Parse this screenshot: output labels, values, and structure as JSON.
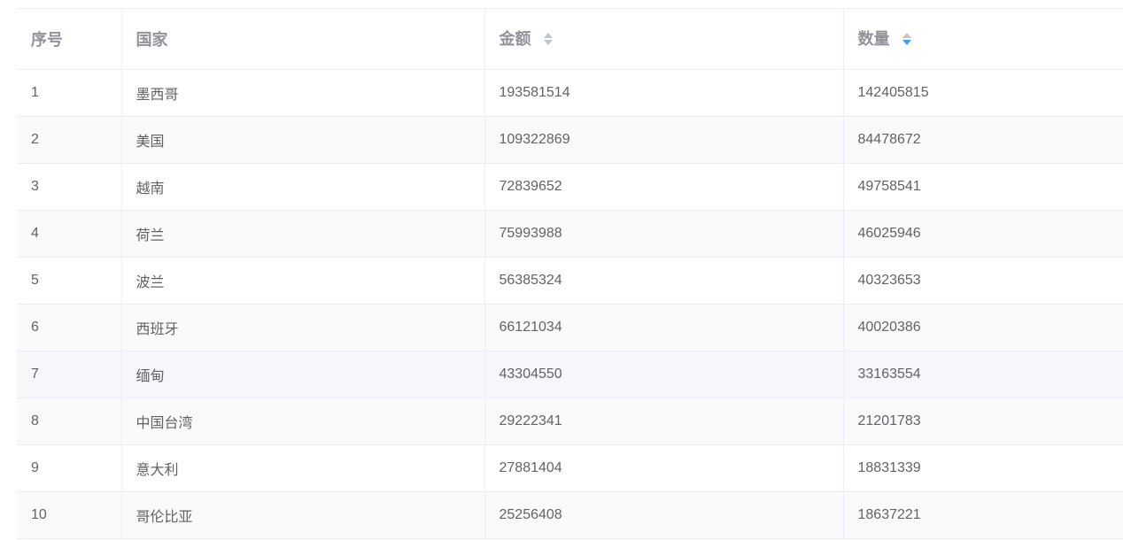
{
  "table": {
    "headers": {
      "index": "序号",
      "country": "国家",
      "amount": "金额",
      "quantity": "数量"
    },
    "sort": {
      "column": "quantity",
      "active_caret": "down",
      "active_color": "#409eff",
      "inactive_color": "#c0c4cc"
    },
    "rows": [
      {
        "index": "1",
        "country": "墨西哥",
        "amount": "193581514",
        "quantity": "142405815"
      },
      {
        "index": "2",
        "country": "美国",
        "amount": "109322869",
        "quantity": "84478672"
      },
      {
        "index": "3",
        "country": "越南",
        "amount": "72839652",
        "quantity": "49758541"
      },
      {
        "index": "4",
        "country": "荷兰",
        "amount": "75993988",
        "quantity": "46025946"
      },
      {
        "index": "5",
        "country": "波兰",
        "amount": "56385324",
        "quantity": "40323653"
      },
      {
        "index": "6",
        "country": "西班牙",
        "amount": "66121034",
        "quantity": "40020386"
      },
      {
        "index": "7",
        "country": "缅甸",
        "amount": "43304550",
        "quantity": "33163554"
      },
      {
        "index": "8",
        "country": "中国台湾",
        "amount": "29222341",
        "quantity": "21201783"
      },
      {
        "index": "9",
        "country": "意大利",
        "amount": "27881404",
        "quantity": "18831339"
      },
      {
        "index": "10",
        "country": "哥伦比亚",
        "amount": "25256408",
        "quantity": "18637221"
      }
    ],
    "hovered_row": 7
  }
}
